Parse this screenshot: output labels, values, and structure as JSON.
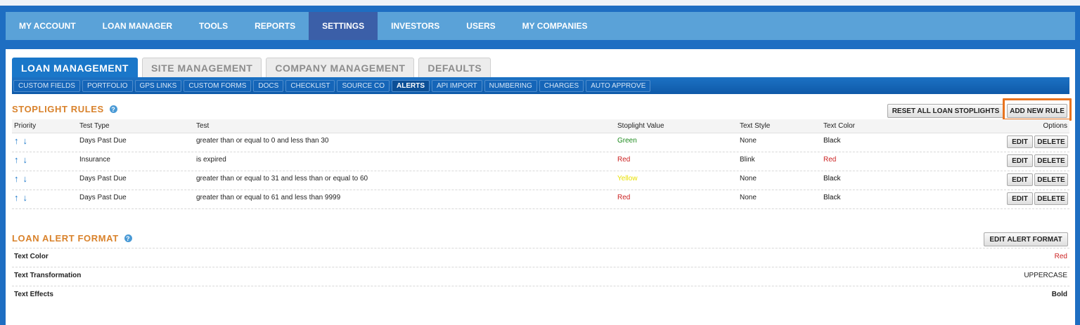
{
  "main_nav": {
    "items": [
      "MY ACCOUNT",
      "LOAN MANAGER",
      "TOOLS",
      "REPORTS",
      "SETTINGS",
      "INVESTORS",
      "USERS",
      "MY COMPANIES"
    ],
    "active": "SETTINGS"
  },
  "tabs": {
    "items": [
      "LOAN MANAGEMENT",
      "SITE MANAGEMENT",
      "COMPANY MANAGEMENT",
      "DEFAULTS"
    ],
    "active": "LOAN MANAGEMENT"
  },
  "subtabs": {
    "items": [
      "CUSTOM FIELDS",
      "PORTFOLIO",
      "GPS LINKS",
      "CUSTOM FORMS",
      "DOCS",
      "CHECKLIST",
      "SOURCE CO",
      "ALERTS",
      "API IMPORT",
      "NUMBERING",
      "CHARGES",
      "AUTO APPROVE"
    ],
    "active": "ALERTS"
  },
  "stoplight": {
    "title": "STOPLIGHT RULES",
    "reset_label": "RESET ALL LOAN STOPLIGHTS",
    "add_label": "ADD NEW RULE",
    "columns": {
      "priority": "Priority",
      "test_type": "Test Type",
      "test": "Test",
      "stoplight_value": "Stoplight Value",
      "text_style": "Text Style",
      "text_color": "Text Color",
      "options": "Options"
    },
    "rows": [
      {
        "test_type": "Days Past Due",
        "test": "greater than or equal to 0 and less than 30",
        "stoplight_value": "Green",
        "stoplight_color": "#1e8a1e",
        "text_style": "None",
        "text_color": "Black",
        "text_color_hex": "#111111"
      },
      {
        "test_type": "Insurance",
        "test": "is expired",
        "stoplight_value": "Red",
        "stoplight_color": "#cc2222",
        "text_style": "Blink",
        "text_color": "Red",
        "text_color_hex": "#cc2222"
      },
      {
        "test_type": "Days Past Due",
        "test": "greater than or equal to 31 and less than or equal to 60",
        "stoplight_value": "Yellow",
        "stoplight_color": "#e8e000",
        "text_style": "None",
        "text_color": "Black",
        "text_color_hex": "#111111"
      },
      {
        "test_type": "Days Past Due",
        "test": "greater than or equal to 61 and less than 9999",
        "stoplight_value": "Red",
        "stoplight_color": "#cc2222",
        "text_style": "None",
        "text_color": "Black",
        "text_color_hex": "#111111"
      }
    ],
    "edit_label": "EDIT",
    "delete_label": "DELETE",
    "up_icon": "↑",
    "down_icon": "↓"
  },
  "alert_format": {
    "title": "LOAN ALERT FORMAT",
    "edit_label": "EDIT ALERT FORMAT",
    "rows": [
      {
        "label": "Text Color",
        "value": "Red",
        "value_color": "#cc2222",
        "bold": false
      },
      {
        "label": "Text Transformation",
        "value": "UPPERCASE",
        "value_color": "#222222",
        "bold": false
      },
      {
        "label": "Text Effects",
        "value": "Bold",
        "value_color": "#222222",
        "bold": true
      }
    ]
  },
  "help_icon": "?",
  "accent_color": "#1a77c9",
  "section_title_color": "#d9822b",
  "highlight_color": "#e8731e"
}
